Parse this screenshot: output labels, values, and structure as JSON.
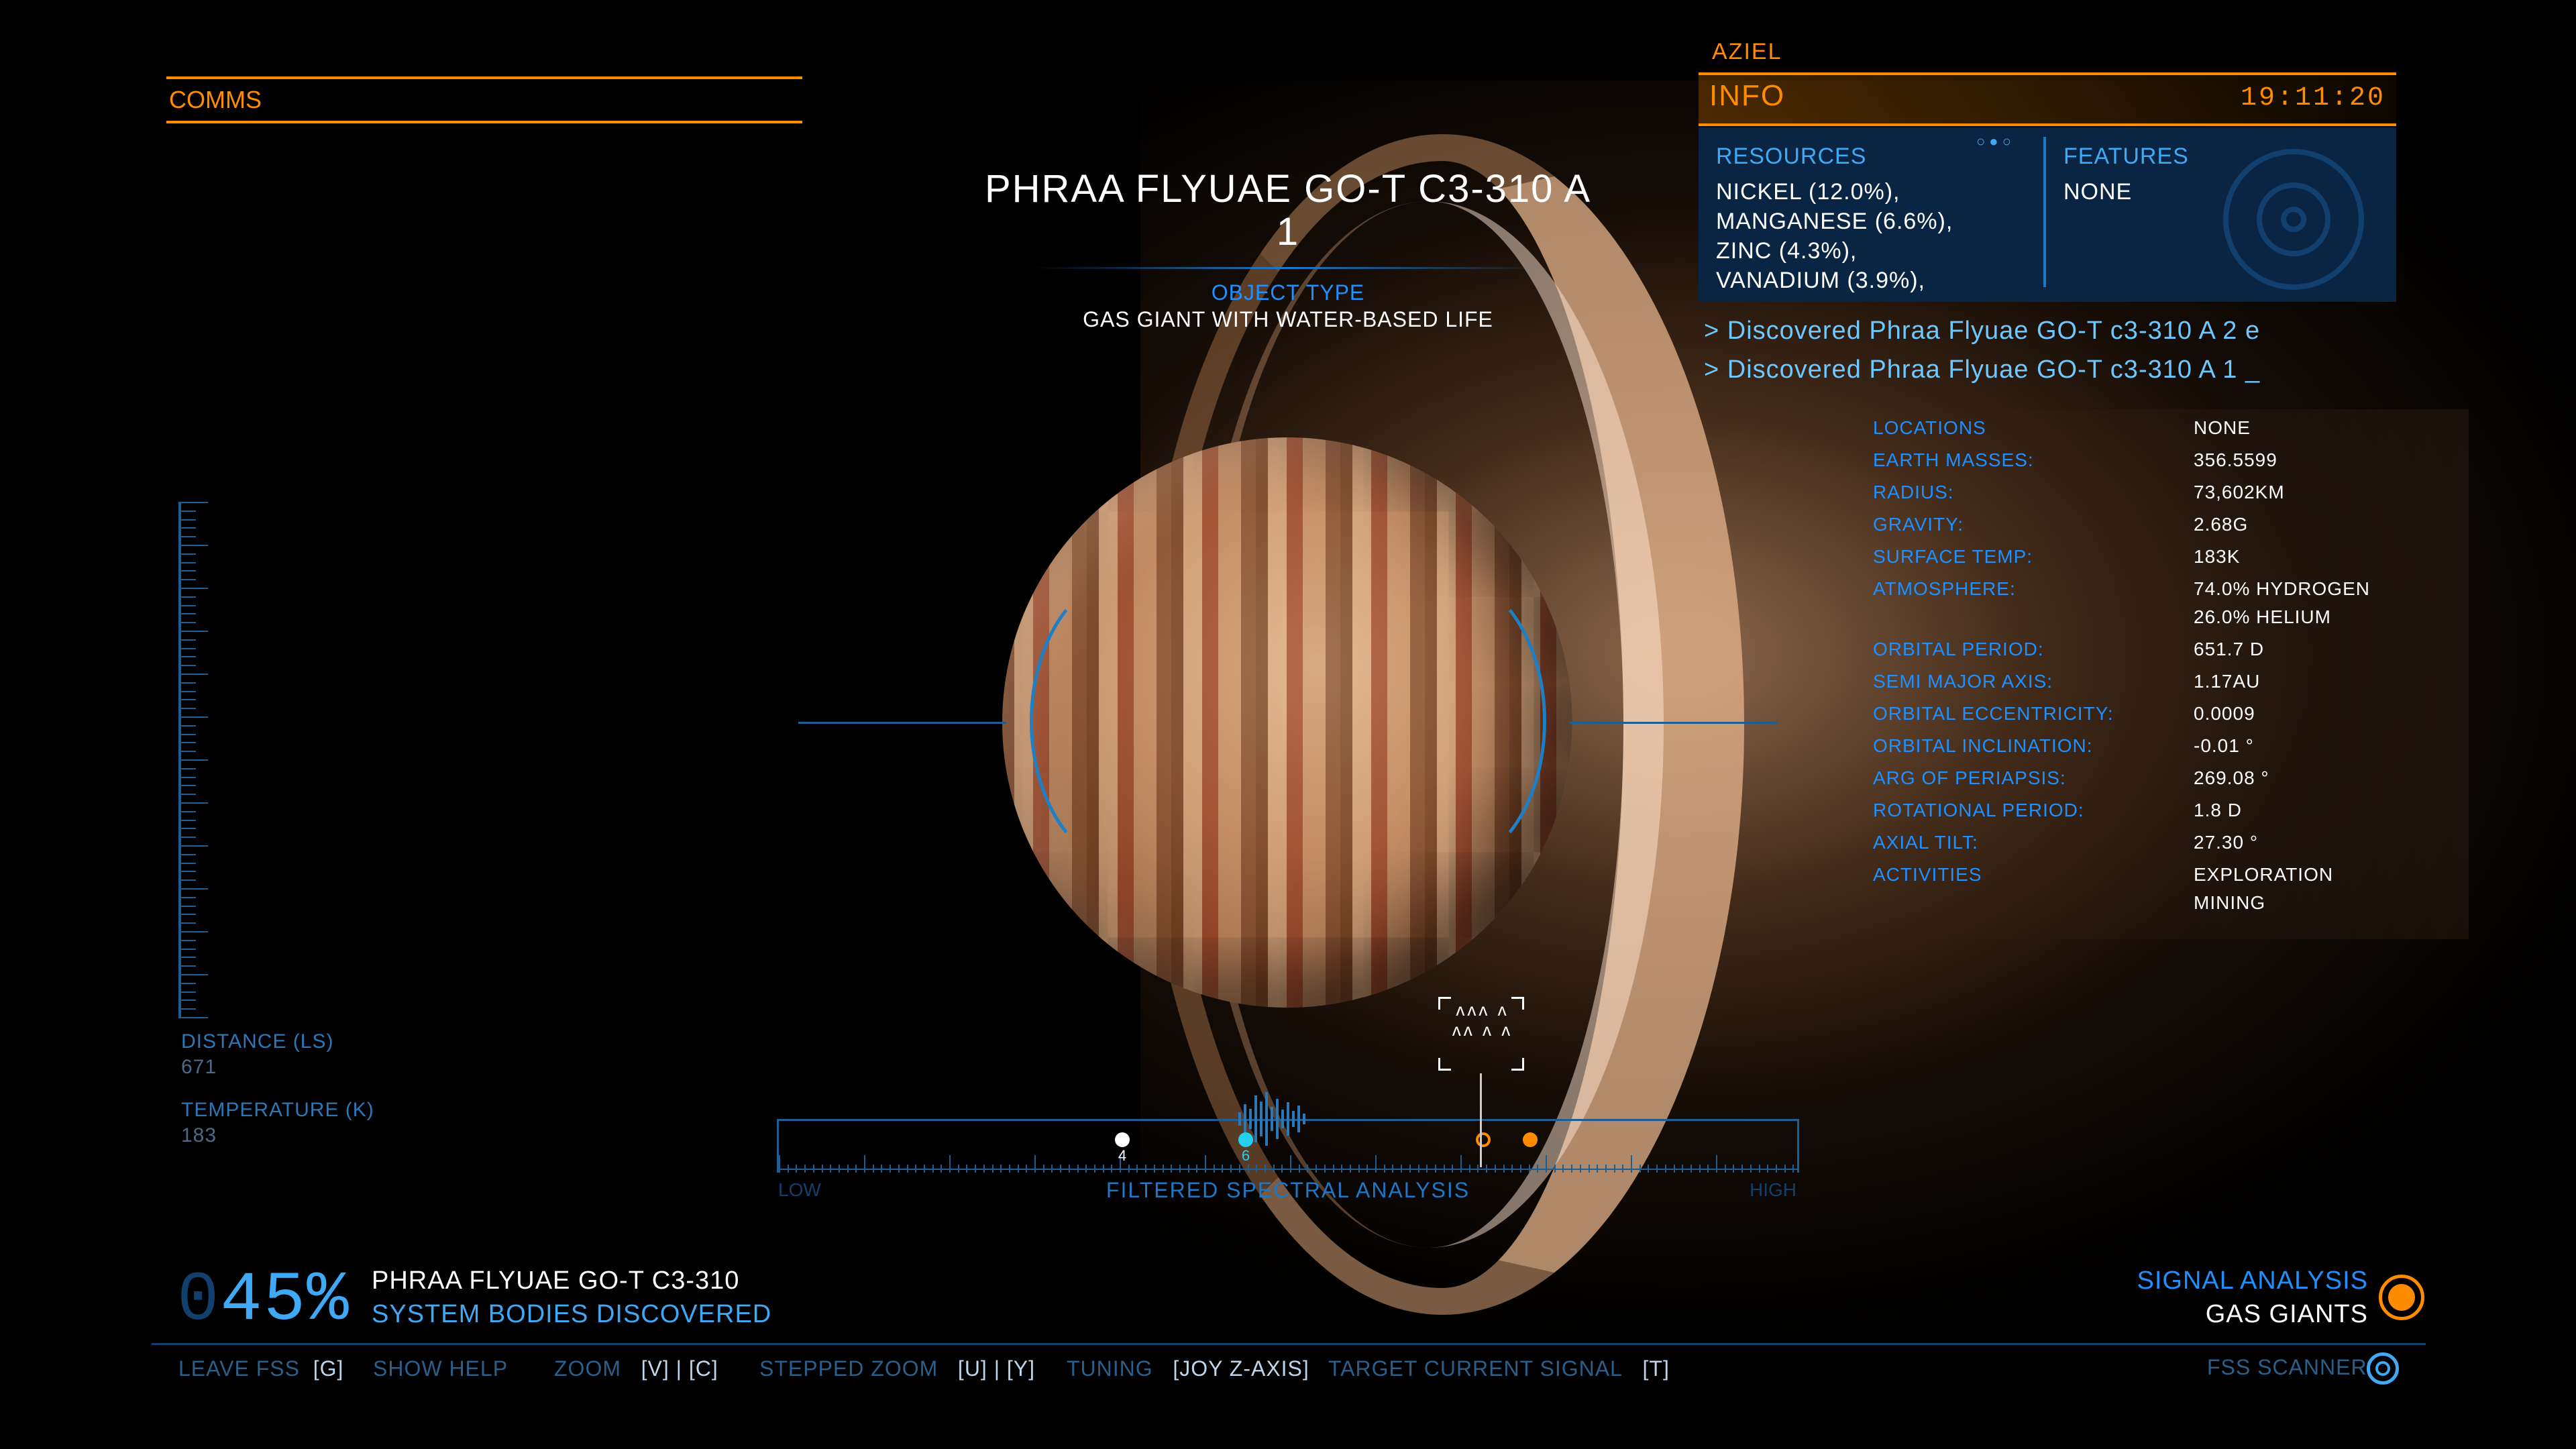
{
  "comms": {
    "label": "COMMS"
  },
  "body": {
    "name_line1": "PHRAA FLYUAE GO-T C3-310 A",
    "name_line2": "1",
    "object_type_label": "OBJECT TYPE",
    "object_type_value": "GAS GIANT WITH WATER-BASED LIFE"
  },
  "left_readout": {
    "distance_label": "DISTANCE (LS)",
    "distance_value": "671",
    "temperature_label": "TEMPERATURE (K)",
    "temperature_value": "183"
  },
  "info_panel": {
    "commander": "AZIEL",
    "title": "INFO",
    "clock": "19:11:20",
    "resources_label": "RESOURCES",
    "resources": [
      "NICKEL (12.0%),",
      "MANGANESE (6.6%),",
      "ZINC (4.3%),",
      "VANADIUM (3.9%),"
    ],
    "features_label": "FEATURES",
    "features_value": "NONE",
    "page_dots": "○●○",
    "log": [
      "> Discovered Phraa Flyuae GO-T c3-310 A 2 e",
      "> Discovered Phraa Flyuae GO-T c3-310 A 1   _"
    ]
  },
  "stats": [
    {
      "k": "LOCATIONS",
      "v": "NONE"
    },
    {
      "k": "EARTH MASSES:",
      "v": "356.5599"
    },
    {
      "k": "RADIUS:",
      "v": "73,602KM"
    },
    {
      "k": "GRAVITY:",
      "v": "2.68G"
    },
    {
      "k": "SURFACE TEMP:",
      "v": "183K"
    },
    {
      "k": "ATMOSPHERE:",
      "v": "74.0% HYDROGEN",
      "v2": "26.0% HELIUM"
    },
    {
      "k": "ORBITAL PERIOD:",
      "v": "651.7 D"
    },
    {
      "k": "SEMI MAJOR AXIS:",
      "v": "1.17AU"
    },
    {
      "k": "ORBITAL ECCENTRICITY:",
      "v": "0.0009"
    },
    {
      "k": "ORBITAL INCLINATION:",
      "v": "-0.01 °"
    },
    {
      "k": "ARG OF PERIAPSIS:",
      "v": "269.08 °"
    },
    {
      "k": "ROTATIONAL PERIOD:",
      "v": "1.8 D"
    },
    {
      "k": "AXIAL TILT:",
      "v": "27.30 °"
    },
    {
      "k": "ACTIVITIES",
      "v": "EXPLORATION",
      "v2": "MINING"
    }
  ],
  "spectral": {
    "low": "LOW",
    "high": "HIGH",
    "title": "FILTERED SPECTRAL ANALYSIS",
    "marker_a": "4",
    "marker_b": "6",
    "chevrons": "ʌʌʌ ʌ ʌʌ ʌ ʌ"
  },
  "progress": {
    "percent_lead": "0",
    "percent_rest": "45%",
    "percent_value": 45,
    "system_name": "PHRAA FLYUAE GO-T C3-310",
    "label": "SYSTEM BODIES DISCOVERED"
  },
  "signal": {
    "label": "SIGNAL ANALYSIS",
    "value": "GAS GIANTS"
  },
  "keybinds": [
    {
      "label": "LEAVE FSS",
      "key": "[G]"
    },
    {
      "label": "SHOW HELP",
      "key": ""
    },
    {
      "label": "ZOOM",
      "key": "[V] | [C]"
    },
    {
      "label": "STEPPED ZOOM",
      "key": "[U] | [Y]"
    },
    {
      "label": "TUNING",
      "key": "[JOY Z-AXIS]"
    },
    {
      "label": "TARGET CURRENT SIGNAL",
      "key": "[T]"
    }
  ],
  "fss_label": "FSS SCANNER",
  "colors": {
    "accent": "#ff8c00",
    "primary_blue": "#3fa9f5",
    "dark_blue": "#12406e"
  },
  "icons": [
    "radar-icon",
    "signal-target-icon",
    "fss-scanner-icon"
  ]
}
